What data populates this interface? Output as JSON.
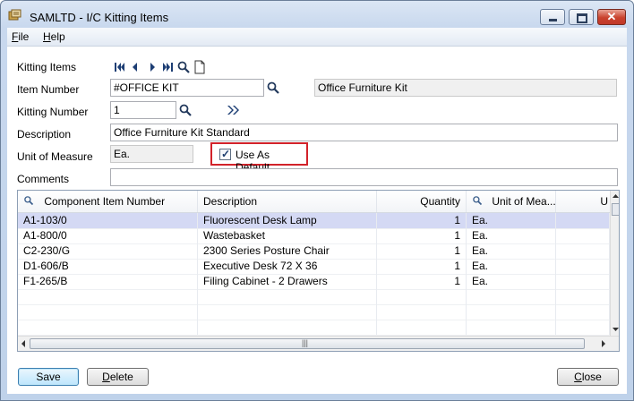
{
  "window": {
    "title": "SAMLTD - I/C Kitting Items",
    "close_glyph": "✕"
  },
  "menu": [
    {
      "label": "File",
      "key": "F"
    },
    {
      "label": "Help",
      "key": "H"
    }
  ],
  "form": {
    "kitting_items_label": "Kitting Items",
    "item_number_label": "Item Number",
    "item_number_value": "#OFFICE KIT",
    "item_description_value": "Office Furniture Kit",
    "kitting_number_label": "Kitting Number",
    "kitting_number_value": "1",
    "description_label": "Description",
    "description_value": "Office Furniture Kit Standard",
    "unit_label": "Unit of Measure",
    "unit_value": "Ea.",
    "use_default_label": "Use As Default",
    "use_default_checked": true,
    "comments_label": "Comments",
    "comments_value": ""
  },
  "grid": {
    "columns": [
      "Component Item Number",
      "Description",
      "Quantity",
      "Unit of Mea...",
      "U"
    ],
    "rows": [
      {
        "item": "A1-103/0",
        "desc": "Fluorescent Desk Lamp",
        "qty": "1",
        "unit": "Ea."
      },
      {
        "item": "A1-800/0",
        "desc": "Wastebasket",
        "qty": "1",
        "unit": "Ea."
      },
      {
        "item": "C2-230/G",
        "desc": "2300 Series Posture Chair",
        "qty": "1",
        "unit": "Ea."
      },
      {
        "item": "D1-606/B",
        "desc": "Executive Desk 72 X 36",
        "qty": "1",
        "unit": "Ea."
      },
      {
        "item": "F1-265/B",
        "desc": "Filing Cabinet - 2 Drawers",
        "qty": "1",
        "unit": "Ea."
      }
    ],
    "selected_row": 0
  },
  "buttons": {
    "save": "Save",
    "delete": "Delete",
    "close": "Close"
  },
  "colors": {
    "selection": "#d4d9f4",
    "highlight_border": "#d2222a",
    "nav_blue": "#1d3e74"
  },
  "icons": [
    "app-icon",
    "first-icon",
    "previous-icon",
    "next-icon",
    "last-icon",
    "finder-icon",
    "new-icon",
    "zoom-icon"
  ]
}
